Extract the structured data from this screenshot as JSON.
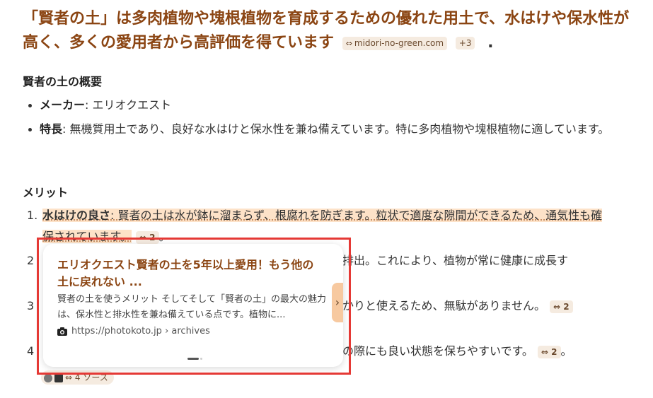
{
  "headline": {
    "text": "「賢者の土」は多肉植物や塊根植物を育成するための優れた用土で、水はけや保水性が高く、多くの愛用者から高評価を得ています",
    "source_chip": "midori-no-green.com",
    "more_chip": "+3",
    "end": "."
  },
  "overview": {
    "title": "賢者の土の概要",
    "items": [
      {
        "label": "メーカー",
        "text": ": エリオクエスト"
      },
      {
        "label": "特長",
        "text": ": 無機質用土であり、良好な水はけと保水性を兼ね備えています。特に多肉植物や塊根植物に適しています。"
      }
    ]
  },
  "merits": {
    "title": "メリット",
    "items": [
      {
        "num": "1.",
        "label": "水はけの良さ",
        "text": ": 賢者の土は水が鉢に溜まらず、根腐れを防ぎます。粒状で適度な隙間ができるため、通気性も確保されています。",
        "chip": "2",
        "end": "。"
      },
      {
        "num": "2",
        "tail": "排出。これにより、植物が常に健康に成長す"
      },
      {
        "num": "3",
        "tail": "かりと使えるため、無駄がありません。",
        "chip": "2"
      },
      {
        "num": "4",
        "tail": "の際にも良い状態を保ちやすいです。",
        "chip": "2",
        "end": "。"
      }
    ]
  },
  "sources_row": {
    "label": "4 ソース"
  },
  "popup": {
    "title": "エリオクエスト賢者の土を5年以上愛用！もう他の土に戻れない ...",
    "snippet": "賢者の土を使うメリット そしてそして「賢者の土」の最大の魅力は、保水性と排水性を兼ね備えている点です。植物に...",
    "source": "https://photokoto.jp › archives",
    "next_glyph": "›"
  },
  "colors": {
    "accent": "#8b4513",
    "highlight": "#fde2c8",
    "chip_bg": "#f5ebe0",
    "frame": "#e53935"
  }
}
